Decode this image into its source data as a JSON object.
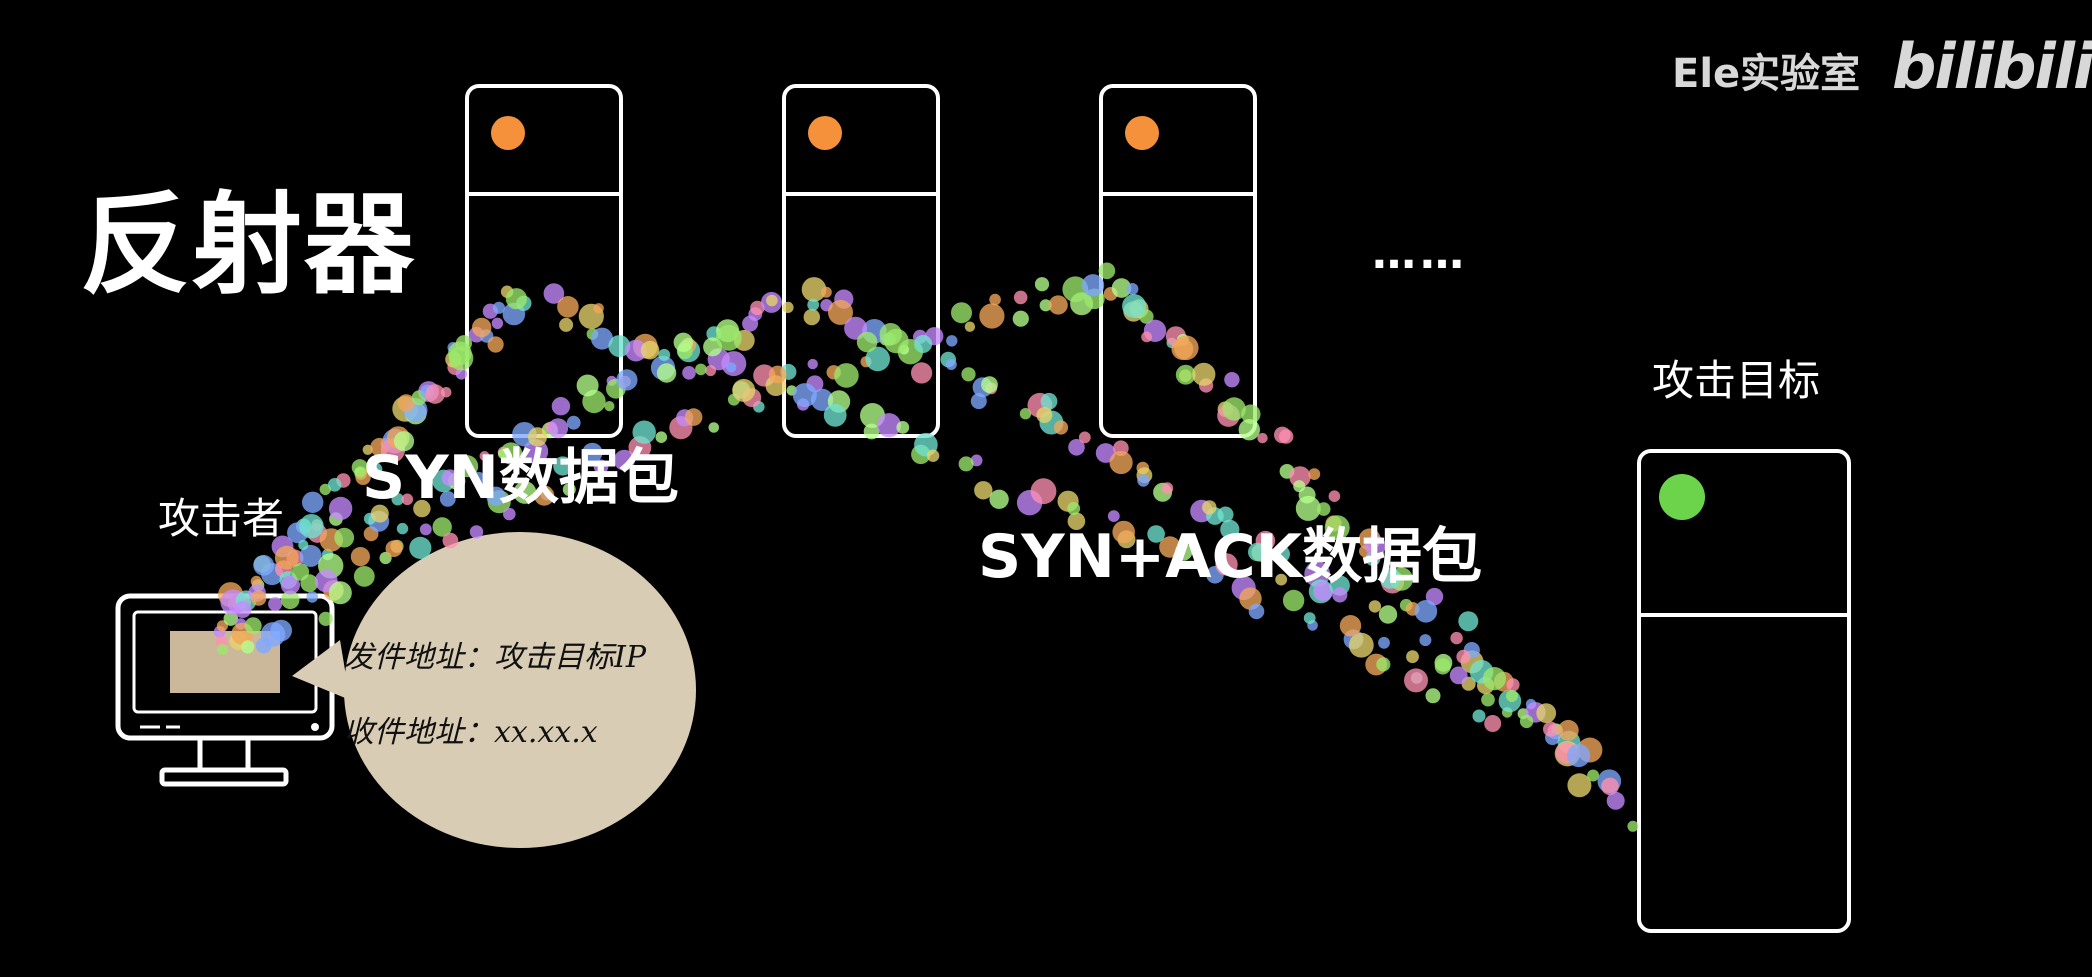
{
  "labels": {
    "title": "反射器",
    "ellipsis": "……",
    "target": "攻击目标",
    "attacker": "攻击者",
    "syn": "SYN数据包",
    "synack": "SYN+ACK数据包",
    "brand": "Ele实验室",
    "logo": "bilibili"
  },
  "letter": {
    "line1": "发件地址：攻击目标IP",
    "line2": "收件地址：xx.xx.x"
  },
  "colors": {
    "reflector_led": "#f4913a",
    "target_led": "#6cd44a",
    "bubble": "#d9ccb4"
  }
}
